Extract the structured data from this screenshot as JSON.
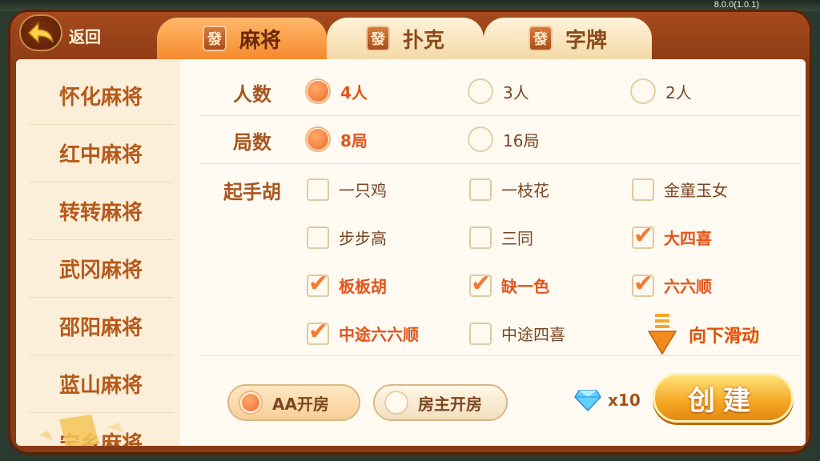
{
  "version": "8.0.0(1.0.1)",
  "header": {
    "back_label": "返回",
    "tabs": [
      {
        "icon_text": "發",
        "label": "麻将",
        "active": true
      },
      {
        "icon_text": "發",
        "label": "扑克",
        "active": false
      },
      {
        "icon_text": "發",
        "label": "字牌",
        "active": false
      }
    ]
  },
  "sidebar": {
    "items": [
      {
        "label": "怀化麻将"
      },
      {
        "label": "红中麻将"
      },
      {
        "label": "转转麻将"
      },
      {
        "label": "武冈麻将"
      },
      {
        "label": "邵阳麻将"
      },
      {
        "label": "蓝山麻将"
      },
      {
        "label": "宁乡麻将"
      }
    ]
  },
  "settings": {
    "players": {
      "label": "人数",
      "options": [
        {
          "label": "4人",
          "selected": true
        },
        {
          "label": "3人",
          "selected": false
        },
        {
          "label": "2人",
          "selected": false
        }
      ]
    },
    "rounds": {
      "label": "局数",
      "options": [
        {
          "label": "8局",
          "selected": true
        },
        {
          "label": "16局",
          "selected": false
        }
      ]
    },
    "starting_hu": {
      "label": "起手胡",
      "options": [
        {
          "label": "一只鸡",
          "checked": false
        },
        {
          "label": "一枝花",
          "checked": false
        },
        {
          "label": "金童玉女",
          "checked": false
        },
        {
          "label": "步步高",
          "checked": false
        },
        {
          "label": "三同",
          "checked": false
        },
        {
          "label": "大四喜",
          "checked": true
        },
        {
          "label": "板板胡",
          "checked": true
        },
        {
          "label": "缺一色",
          "checked": true
        },
        {
          "label": "六六顺",
          "checked": true
        },
        {
          "label": "中途六六顺",
          "checked": true
        },
        {
          "label": "中途四喜",
          "checked": false
        }
      ]
    },
    "scroll_hint": "向下滑动"
  },
  "footer": {
    "pay_options": [
      {
        "label": "AA开房",
        "selected": true
      },
      {
        "label": "房主开房",
        "selected": false
      }
    ],
    "cost": "x10",
    "create_label": "创建"
  },
  "colors": {
    "accent": "#ef6b26",
    "frame": "#8a3b16",
    "panel": "#fdf6e9"
  }
}
